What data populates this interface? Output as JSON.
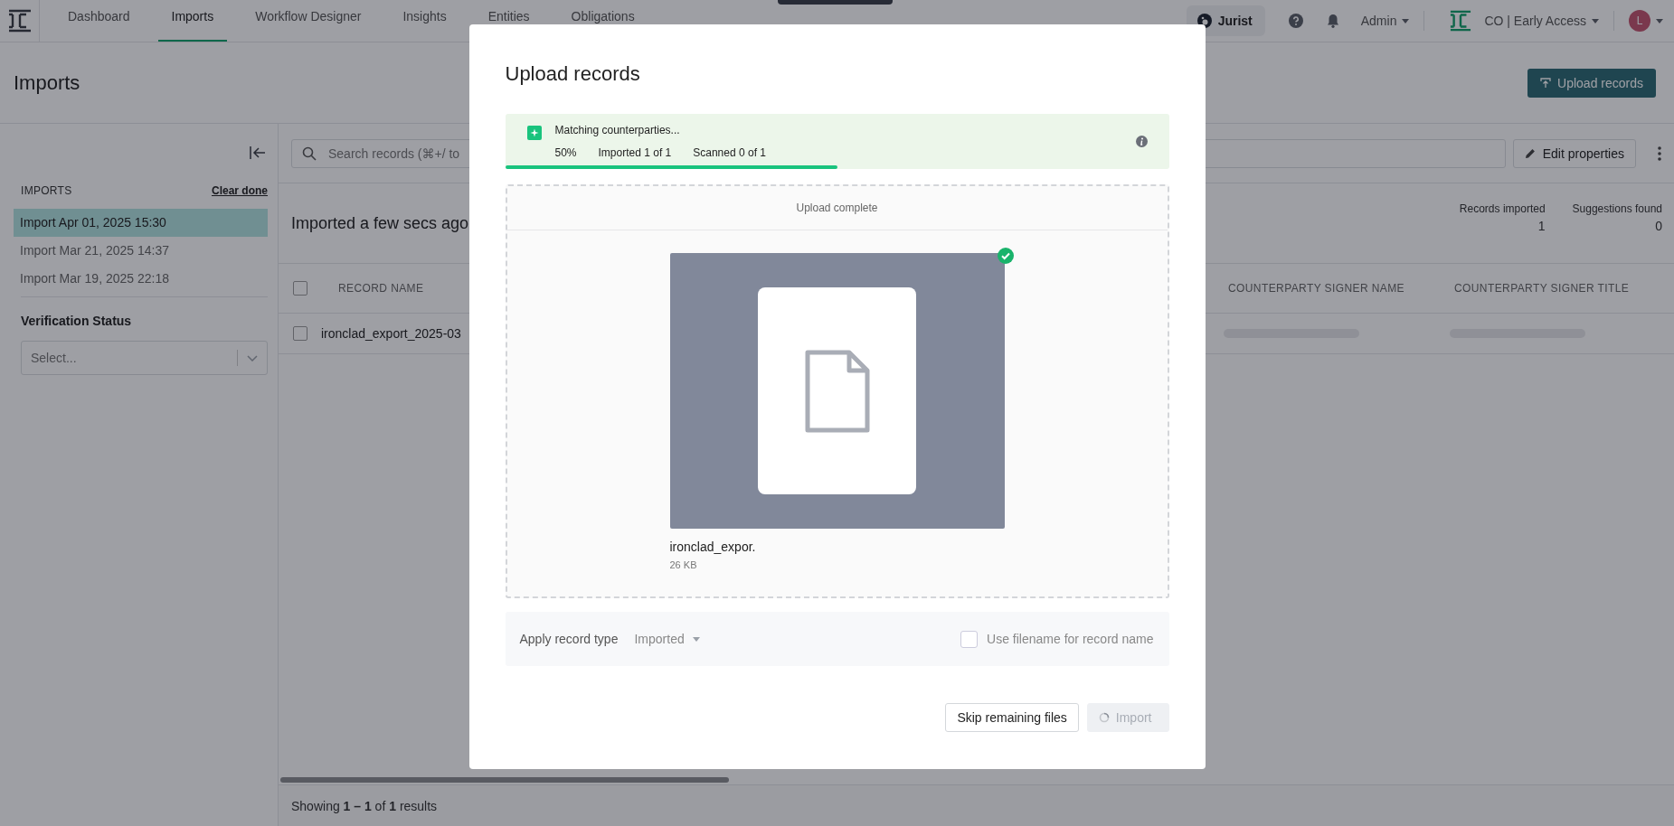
{
  "nav": {
    "tabs": [
      {
        "label": "Dashboard",
        "selected": false
      },
      {
        "label": "Imports",
        "selected": true
      },
      {
        "label": "Workflow Designer",
        "selected": false
      },
      {
        "label": "Insights",
        "selected": false
      },
      {
        "label": "Entities",
        "selected": false
      },
      {
        "label": "Obligations",
        "selected": false
      }
    ],
    "jurist": "Jurist",
    "admin": "Admin",
    "workspace": "CO | Early Access",
    "avatar": "L"
  },
  "page": {
    "title": "Imports",
    "upload_button": "Upload records"
  },
  "sidebar": {
    "heading": "IMPORTS",
    "clear": "Clear done",
    "items": [
      {
        "label": "Import Apr 01, 2025 15:30",
        "selected": true
      },
      {
        "label": "Import Mar 21, 2025 14:37",
        "selected": false
      },
      {
        "label": "Import Mar 19, 2025 22:18",
        "selected": false
      }
    ],
    "filter_label": "Verification Status",
    "filter_placeholder": "Select..."
  },
  "toolbar": {
    "search_placeholder": "Search records (⌘+/ to",
    "edit_button": "Edit properties"
  },
  "summary": {
    "title": "Imported a few secs ago",
    "stats": [
      {
        "label": "Records imported",
        "value": "1"
      },
      {
        "label": "Suggestions found",
        "value": "0"
      }
    ]
  },
  "table": {
    "all_checked": false,
    "columns": [
      "RECORD NAME",
      "COUNTERPARTY SIGNER NAME",
      "COUNTERPARTY SIGNER TITLE"
    ],
    "rows": [
      {
        "record_name": "ironclad_export_2025-03",
        "checked": false
      }
    ]
  },
  "footer": "Showing **1 – 1** of **1** results",
  "modal": {
    "title": "Upload records",
    "status": {
      "message": "Matching counterparties...",
      "percent": "50%",
      "imported": "Imported 1 of 1",
      "scanned": "Scanned 0 of 1",
      "level": 0.5
    },
    "dropzone": {
      "header": "Upload complete",
      "files": [
        {
          "name": "ironclad_expor.",
          "size": "26 KB",
          "done": true
        }
      ]
    },
    "options": {
      "record_type_label": "Apply record type",
      "record_type": "Imported",
      "use_filename": {
        "label": "Use filename for record name",
        "checked": false
      }
    },
    "buttons": [
      {
        "label": "Skip remaining files",
        "kind": "secondary",
        "loading": false,
        "disabled": false
      },
      {
        "label": "Import",
        "kind": "primary",
        "loading": true,
        "disabled": true
      }
    ]
  }
}
